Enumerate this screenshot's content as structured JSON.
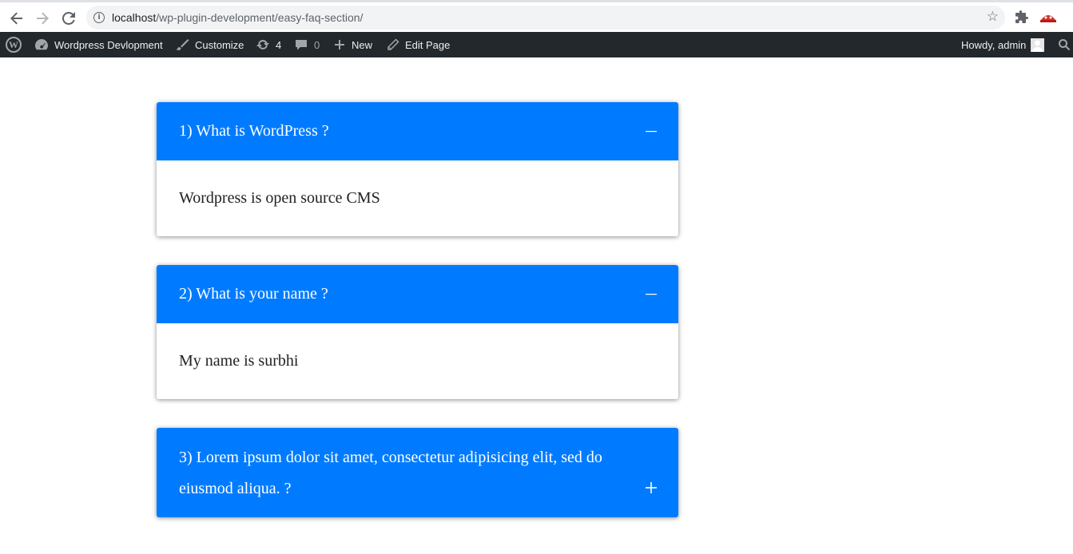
{
  "browser": {
    "url_host": "localhost",
    "url_path": "/wp-plugin-development/easy-faq-section/"
  },
  "adminbar": {
    "site_name": "Wordpress Devlopment",
    "customize_label": "Customize",
    "updates_count": "4",
    "comments_count": "0",
    "new_label": "New",
    "edit_page_label": "Edit Page",
    "greeting": "Howdy, admin"
  },
  "faq": {
    "accent_color": "#007bff",
    "items": [
      {
        "question": "1) What is WordPress ?",
        "answer": "Wordpress is open source CMS",
        "toggle": "−",
        "expanded": true
      },
      {
        "question": "2) What is your name ?",
        "answer": "My name is surbhi",
        "toggle": "−",
        "expanded": true
      },
      {
        "question": "3) Lorem ipsum dolor sit amet, consectetur adipisicing elit, sed do eiusmod aliqua. ?",
        "answer": "",
        "toggle": "+",
        "expanded": false
      }
    ]
  },
  "icons": {
    "back": "arrow-left-icon",
    "forward": "arrow-right-icon",
    "reload": "reload-icon",
    "info": "info-icon",
    "bookmark": "star-icon",
    "extensions": "puzzle-icon",
    "wp": "wordpress-logo-icon",
    "dashboard": "dashboard-icon",
    "customize": "paintbrush-icon",
    "updates": "updates-icon",
    "comments": "comment-icon",
    "new": "plus-icon",
    "edit": "pencil-icon",
    "search": "search-icon"
  }
}
